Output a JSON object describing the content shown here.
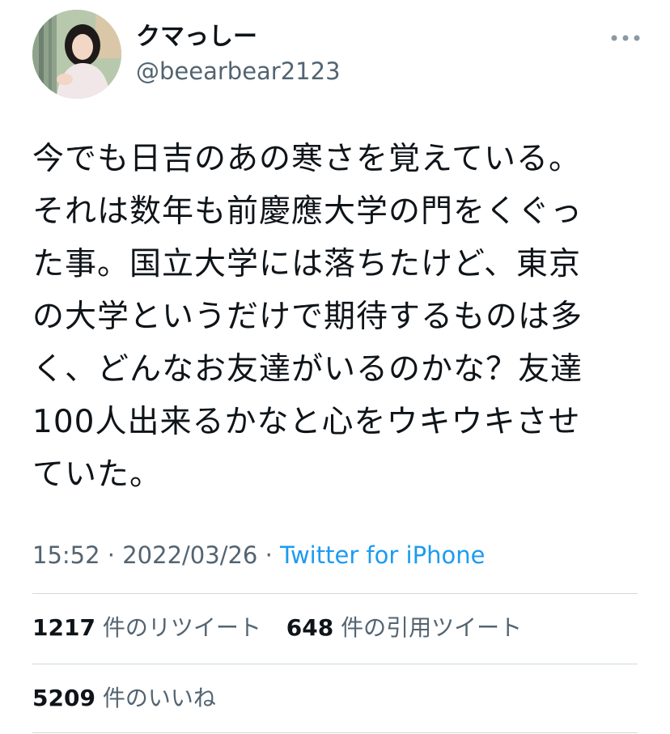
{
  "header": {
    "display_name": "クマっしー",
    "handle": "@beearbear2123",
    "more_icon": "more-horizontal-icon"
  },
  "tweet": {
    "lines": [
      "今でも日吉のあの寒さを覚えている。",
      "それは数年も前慶應大学の門をくぐっ",
      "た事。国立大学には落ちたけど、東京",
      "の大学というだけで期待するものは多",
      "く、どんなお友達がいるのかな？友達",
      "100人出来るかなと心をウキウキさせ",
      "ていた。"
    ]
  },
  "meta": {
    "time": "15:52",
    "separator": "·",
    "date": "2022/03/26",
    "source": "Twitter for iPhone"
  },
  "stats": {
    "retweets_count": "1217",
    "retweets_label": "件のリツイート",
    "quotes_count": "648",
    "quotes_label": "件の引用ツイート",
    "likes_count": "5209",
    "likes_label": "件のいいね"
  },
  "colors": {
    "text": "#0f1419",
    "secondary": "#536471",
    "link": "#1d9bf0",
    "divider": "#cfd9de"
  }
}
